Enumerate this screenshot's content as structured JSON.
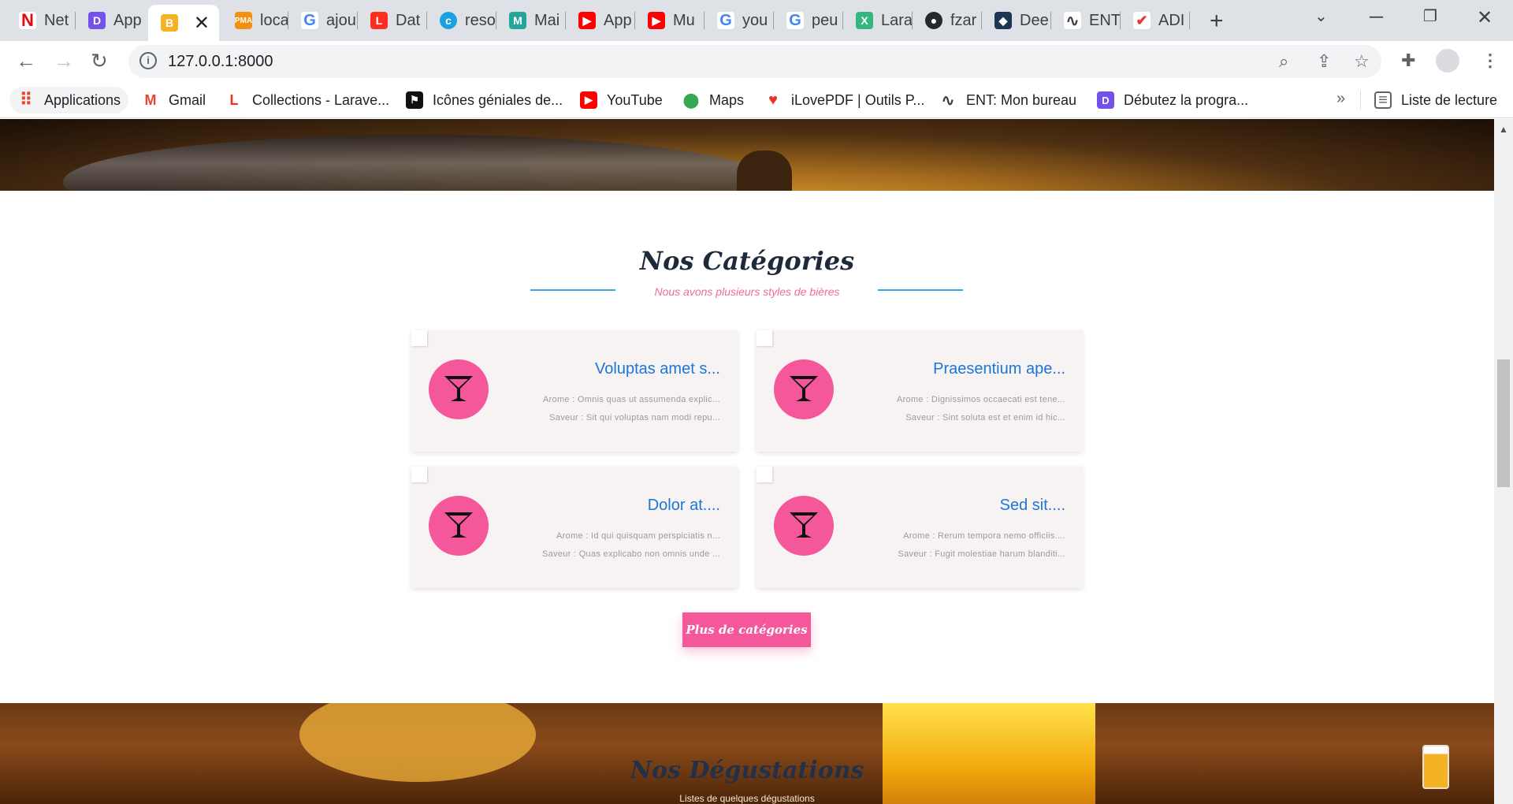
{
  "browser": {
    "tabs": [
      {
        "title": "Net",
        "icon": "netflix-icon",
        "color": "#e50914",
        "glyph": "N"
      },
      {
        "title": "App",
        "icon": "openclassrooms-icon",
        "color": "#7451eb",
        "glyph": "D"
      },
      {
        "title": "",
        "icon": "beer-mug-icon",
        "color": "#f4b322",
        "glyph": "🍺",
        "active": true
      },
      {
        "title": "loca",
        "icon": "phpmyadmin-icon",
        "color": "#f29111",
        "glyph": "P"
      },
      {
        "title": "ajou",
        "icon": "google-icon",
        "color": "#4285f4",
        "glyph": "G"
      },
      {
        "title": "Dat",
        "icon": "laravel-icon",
        "color": "#ff2d20",
        "glyph": "L"
      },
      {
        "title": "reso",
        "icon": "cloud-icon",
        "color": "#1ba1e2",
        "glyph": "c"
      },
      {
        "title": "Mai",
        "icon": "mail-app-icon",
        "color": "#26a69a",
        "glyph": "M"
      },
      {
        "title": "App",
        "icon": "youtube-icon",
        "color": "#ff0000",
        "glyph": "▶"
      },
      {
        "title": "Mu",
        "icon": "youtube-icon",
        "color": "#ff0000",
        "glyph": "▶"
      },
      {
        "title": "you",
        "icon": "google-icon",
        "color": "#4285f4",
        "glyph": "G"
      },
      {
        "title": "peu",
        "icon": "google-icon",
        "color": "#4285f4",
        "glyph": "G"
      },
      {
        "title": "Lara",
        "icon": "laracasts-icon",
        "color": "#34b77e",
        "glyph": "X"
      },
      {
        "title": "fzar",
        "icon": "github-icon",
        "color": "#24292e",
        "glyph": "●"
      },
      {
        "title": "Dee",
        "icon": "deepnote-icon",
        "color": "#1e3553",
        "glyph": "◆"
      },
      {
        "title": "ENT",
        "icon": "ent-icon",
        "color": "#3c4043",
        "glyph": "∿"
      },
      {
        "title": "ADI",
        "icon": "adi-icon",
        "color": "#e53935",
        "glyph": "✔"
      }
    ],
    "address": "127.0.0.1:8000",
    "bookmarks": [
      {
        "label": "Applications",
        "icon": "apps-grid-icon",
        "color": "#ea4335",
        "glyph": "⠿"
      },
      {
        "label": "Gmail",
        "icon": "gmail-icon",
        "color": "#ea4335",
        "glyph": "M"
      },
      {
        "label": "Collections - Larave...",
        "icon": "laravel-icon",
        "color": "#ff2d20",
        "glyph": "L"
      },
      {
        "label": "Icônes géniales de...",
        "icon": "fontawesome-icon",
        "color": "#111111",
        "glyph": "⚑"
      },
      {
        "label": "YouTube",
        "icon": "youtube-icon",
        "color": "#ff0000",
        "glyph": "▶"
      },
      {
        "label": "Maps",
        "icon": "maps-pin-icon",
        "color": "#34a853",
        "glyph": "⬤"
      },
      {
        "label": "iLovePDF | Outils P...",
        "icon": "ilovepdf-icon",
        "color": "#e5322d",
        "glyph": "♥"
      },
      {
        "label": "ENT: Mon bureau",
        "icon": "ent-icon",
        "color": "#3c4043",
        "glyph": "∿"
      },
      {
        "label": "Débutez la progra...",
        "icon": "openclassrooms-icon",
        "color": "#7451eb",
        "glyph": "D"
      }
    ],
    "bookmarks_more": "»",
    "reading_list": "Liste de lecture"
  },
  "page": {
    "categories_section": {
      "title": "Nos Catégories",
      "subtitle": "Nous avons plusieurs styles de bières",
      "cards": [
        {
          "title": "Voluptas amet s...",
          "arome": "Arome : Omnis quas ut assumenda explic...",
          "saveur": "Saveur : Sit qui voluptas nam modi repu..."
        },
        {
          "title": "Praesentium ape...",
          "arome": "Arome : Dignissimos occaecati est tene...",
          "saveur": "Saveur : Sint soluta est et enim id hic..."
        },
        {
          "title": "Dolor at....",
          "arome": "Arome : Id qui quisquam perspiciatis n...",
          "saveur": "Saveur : Quas explicabo non omnis unde ..."
        },
        {
          "title": "Sed sit....",
          "arome": "Arome : Rerum tempora nemo officiis....",
          "saveur": "Saveur : Fugit molestiae harum blanditi..."
        }
      ],
      "more_button": "Plus de catégories"
    },
    "tastings_section": {
      "title": "Nos Dégustations",
      "subtitle": "Listes de quelques dégustations"
    }
  },
  "colors": {
    "accent_pink": "#f5589a",
    "title_blue": "#1b76d8",
    "line_blue": "#3aa3e0"
  }
}
